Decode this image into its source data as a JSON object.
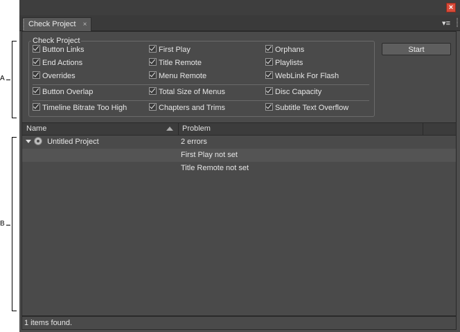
{
  "callouts": {
    "a": "A",
    "b": "B"
  },
  "tab": {
    "label": "Check Project"
  },
  "group": {
    "title": "Check Project",
    "checks": [
      {
        "label": "Button Links"
      },
      {
        "label": "First Play"
      },
      {
        "label": "Orphans"
      },
      {
        "label": "End Actions"
      },
      {
        "label": "Title Remote"
      },
      {
        "label": "Playlists"
      },
      {
        "label": "Overrides"
      },
      {
        "label": "Menu Remote"
      },
      {
        "label": "WebLink For Flash"
      },
      {
        "label": "Button Overlap"
      },
      {
        "label": "Total Size of Menus"
      },
      {
        "label": "Disc Capacity"
      },
      {
        "label": "Timeline Bitrate Too High"
      },
      {
        "label": "Chapters and Trims"
      },
      {
        "label": "Subtitle Text Overflow"
      }
    ]
  },
  "start_label": "Start",
  "table": {
    "columns": {
      "name": "Name",
      "problem": "Problem"
    },
    "rows": [
      {
        "name": "Untitled Project",
        "problem": "2 errors"
      },
      {
        "name": "",
        "problem": "First Play not set"
      },
      {
        "name": "",
        "problem": "Title Remote not set"
      }
    ]
  },
  "status": "1 items found.",
  "colors": {
    "panel": "#4a4a4a",
    "close": "#d84a38"
  }
}
